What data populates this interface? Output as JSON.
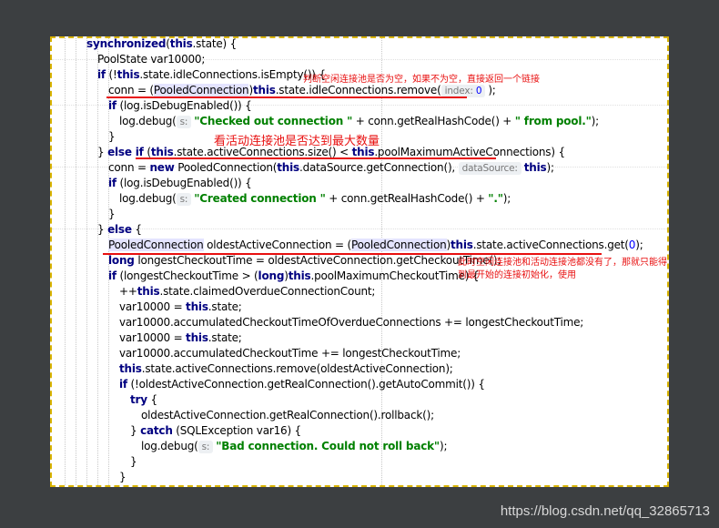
{
  "code": {
    "l1": {
      "kw1": "synchronized",
      "t1": "(",
      "kw2": "this",
      "t2": ".state) {"
    },
    "l2": {
      "t1": "PoolState var10000;"
    },
    "l3": {
      "kw1": "if",
      "t1": " (!",
      "kw2": "this",
      "t2": ".state.idleConnections.isEmpty()) {"
    },
    "l4": {
      "t1": "conn = (",
      "cast": "PooledConnection",
      "t2": ")",
      "kw1": "this",
      "t3": ".state.idleConnections.remove(",
      "hint": "index:",
      "hintv": "0",
      "t4": ");"
    },
    "l5": {
      "kw1": "if",
      "t1": " (log.isDebugEnabled()) {"
    },
    "l6": {
      "t1": "log.debug(",
      "hint": "s:",
      "str": "\"Checked out connection \"",
      "t2": " + conn.getRealHashCode() + ",
      "str2": "\" from pool.\"",
      "t3": ");"
    },
    "l7": {
      "t1": "}"
    },
    "l8": {
      "t1": "} ",
      "kw1": "else if",
      "t2": " (",
      "kw2": "this",
      "t3": ".state.activeConnections.size() < ",
      "kw3": "this",
      "t4": ".poolMaximumActiveConnections) {"
    },
    "l9": {
      "t1": "conn = ",
      "kw1": "new",
      "t2": " PooledConnection(",
      "kw2": "this",
      "t3": ".dataSource.getConnection(), ",
      "hint": "dataSource:",
      "kw3": "this",
      "t4": ");"
    },
    "l10": {
      "kw1": "if",
      "t1": " (log.isDebugEnabled()) {"
    },
    "l11": {
      "t1": "log.debug(",
      "hint": "s:",
      "str": "\"Created connection \"",
      "t2": " + conn.getRealHashCode() + ",
      "str2": "\".\"",
      "t3": ");"
    },
    "l12": {
      "t1": "}"
    },
    "l13": {
      "t1": "} ",
      "kw1": "else",
      "t2": " {"
    },
    "l14": {
      "cast1": "PooledConnection",
      "t1": " oldestActiveConnection = (",
      "cast2": "PooledConnection",
      "t2": ")",
      "kw1": "this",
      "t3": ".state.activeConnections.get(",
      "num": "0",
      "t4": ");"
    },
    "l15": {
      "kw1": "long",
      "t1": " longestCheckoutTime = oldestActiveConnection.getCheckoutTime();"
    },
    "l16": {
      "kw1": "if",
      "t1": " (longestCheckoutTime > (",
      "kw2": "long",
      "t2": ")",
      "kw3": "this",
      "t3": ".poolMaximumCheckoutTime) {"
    },
    "l17": {
      "t1": "++",
      "kw1": "this",
      "t2": ".state.claimedOverdueConnectionCount;"
    },
    "l18": {
      "t1": "var10000 = ",
      "kw1": "this",
      "t2": ".state;"
    },
    "l19": {
      "t1": "var10000.accumulatedCheckoutTimeOfOverdueConnections += longestCheckoutTime;"
    },
    "l20": {
      "t1": "var10000 = ",
      "kw1": "this",
      "t2": ".state;"
    },
    "l21": {
      "t1": "var10000.accumulatedCheckoutTime += longestCheckoutTime;"
    },
    "l22": {
      "kw1": "this",
      "t1": ".state.activeConnections.remove(oldestActiveConnection);"
    },
    "l23": {
      "kw1": "if",
      "t1": " (!oldestActiveConnection.getRealConnection().getAutoCommit()) {"
    },
    "l24": {
      "kw1": "try",
      "t1": " {"
    },
    "l25": {
      "t1": "oldestActiveConnection.getRealConnection().rollback();"
    },
    "l26": {
      "t1": "} ",
      "kw1": "catch",
      "t2": " (SQLException var16) {"
    },
    "l27": {
      "t1": "log.debug(",
      "hint": "s:",
      "str": "\"Bad connection. Could not roll back\"",
      "t2": ");"
    },
    "l28": {
      "t1": "}"
    },
    "l29": {
      "t1": "}"
    }
  },
  "annotations": {
    "a1": "判断空闲连接池是否为空，如果不为空，直接返回一个链接",
    "a2": "看活动连接池是否达到最大数量",
    "a3_line1": "此时空闲连接池和活动连接池都没有了，那就只能得",
    "a3_line2": "到最开始的连接初始化，使用"
  },
  "watermark": "https://blog.csdn.net/qq_32865713",
  "colors": {
    "keyword": "#000080",
    "string": "#008000",
    "number": "#0000ff",
    "annotation": "#e81010",
    "frame_border": "#d9b400",
    "background": "#3c3f41"
  }
}
